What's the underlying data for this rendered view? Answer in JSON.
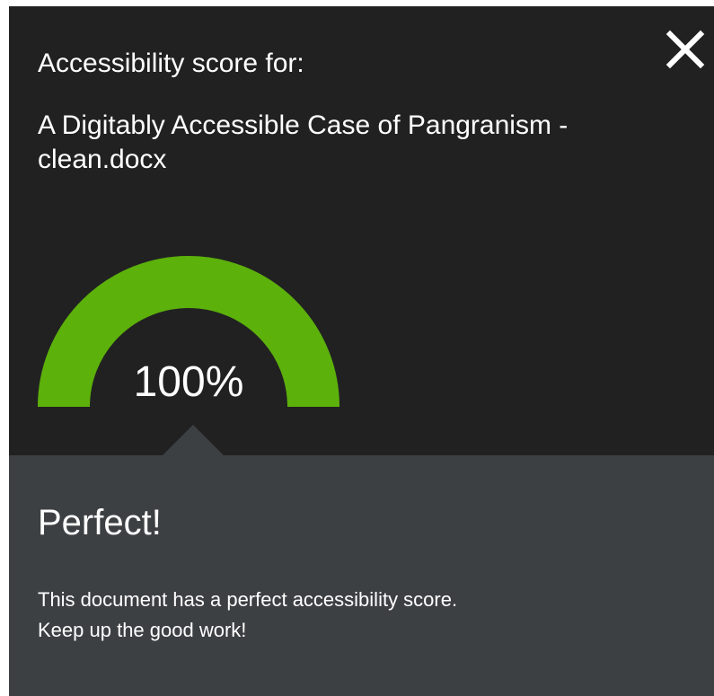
{
  "dialog": {
    "heading": "Accessibility score for:",
    "document_name": "A Digitably Accessible Case of Pangranism - clean.docx",
    "close_icon": "close-icon"
  },
  "gauge": {
    "value_label": "100%",
    "score_fraction": 1.0,
    "fill_color": "#5cb10a",
    "track_color": "#3d4043"
  },
  "result": {
    "title": "Perfect!",
    "description_lines": [
      "This document has a perfect accessibility score.",
      "Keep up the good work!"
    ]
  },
  "colors": {
    "dialog_background": "#212121",
    "panel_background": "#3d4043",
    "text": "#ffffff"
  }
}
